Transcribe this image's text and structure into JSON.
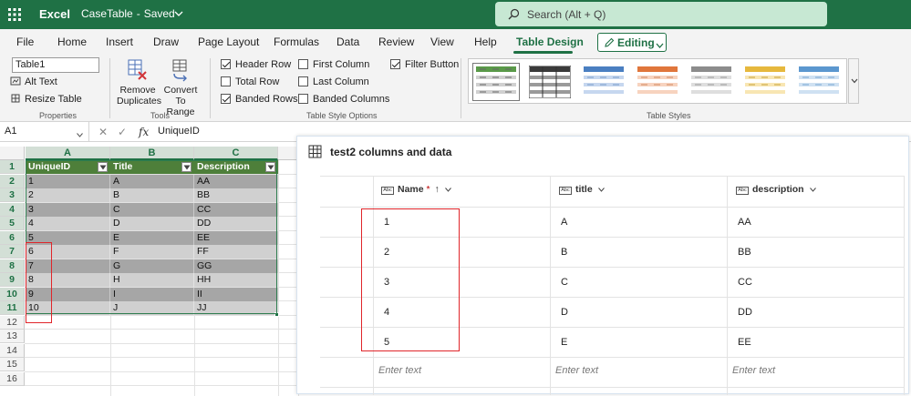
{
  "titlebar": {
    "app_name": "Excel",
    "doc_name": "CaseTable",
    "separator": "-",
    "doc_status": "Saved",
    "search_placeholder": "Search (Alt + Q)"
  },
  "ribbon_tabs": [
    "File",
    "Home",
    "Insert",
    "Draw",
    "Page Layout",
    "Formulas",
    "Data",
    "Review",
    "View",
    "Help",
    "Table Design"
  ],
  "active_tab": "Table Design",
  "editing_mode": "Editing",
  "ribbon": {
    "properties": {
      "table_name": "Table1",
      "alt_text": "Alt Text",
      "resize_table": "Resize Table",
      "label": "Properties"
    },
    "tools": {
      "remove_duplicates_l1": "Remove",
      "remove_duplicates_l2": "Duplicates",
      "convert_range_l1": "Convert To",
      "convert_range_l2": "Range",
      "label": "Tools"
    },
    "style_options": {
      "header_row": "Header Row",
      "total_row": "Total Row",
      "banded_rows": "Banded Rows",
      "first_column": "First Column",
      "last_column": "Last Column",
      "banded_columns": "Banded Columns",
      "filter_button": "Filter Button",
      "header_row_checked": true,
      "total_row_checked": false,
      "banded_rows_checked": true,
      "first_column_checked": false,
      "last_column_checked": false,
      "banded_columns_checked": false,
      "filter_button_checked": true,
      "label": "Table Style Options"
    },
    "table_styles": {
      "label": "Table Styles",
      "swatches": [
        "#5a9a49",
        "#3a3a3a",
        "#4a7fc1",
        "#e0763b",
        "#8c8c8c",
        "#e6b83d",
        "#5b97cf"
      ]
    }
  },
  "formula_bar": {
    "name_box": "A1",
    "cancel_glyph": "✕",
    "enter_glyph": "✓",
    "fx_label": "fx",
    "value": "UniqueID"
  },
  "sheet": {
    "columns": [
      "A",
      "B",
      "C"
    ],
    "rows": [
      "1",
      "2",
      "3",
      "4",
      "5",
      "6",
      "7",
      "8",
      "9",
      "10",
      "11",
      "12",
      "13",
      "14",
      "15",
      "16"
    ],
    "headers": [
      "UniqueID",
      "Title",
      "Description"
    ],
    "data": [
      [
        "1",
        "A",
        "AA"
      ],
      [
        "2",
        "B",
        "BB"
      ],
      [
        "3",
        "C",
        "CC"
      ],
      [
        "4",
        "D",
        "DD"
      ],
      [
        "5",
        "E",
        "EE"
      ],
      [
        "6",
        "F",
        "FF"
      ],
      [
        "7",
        "G",
        "GG"
      ],
      [
        "8",
        "H",
        "HH"
      ],
      [
        "9",
        "I",
        "II"
      ],
      [
        "10",
        "J",
        "JJ"
      ]
    ],
    "colors": {
      "header_bg": "#4e7f3a",
      "band_dark": "#a6a6a6",
      "band_light": "#d0d0d0",
      "table_border": "#2e7d4f",
      "highlight_red": "#e0252a"
    }
  },
  "panel": {
    "title": "test2 columns and data",
    "columns": [
      {
        "label": "Name",
        "required": "*",
        "sort": "↑"
      },
      {
        "label": "title"
      },
      {
        "label": "description"
      }
    ],
    "type_badge": "Abc",
    "rows": [
      [
        "1",
        "A",
        "AA"
      ],
      [
        "2",
        "B",
        "BB"
      ],
      [
        "3",
        "C",
        "CC"
      ],
      [
        "4",
        "D",
        "DD"
      ],
      [
        "5",
        "E",
        "EE"
      ]
    ],
    "placeholder": "Enter text"
  }
}
